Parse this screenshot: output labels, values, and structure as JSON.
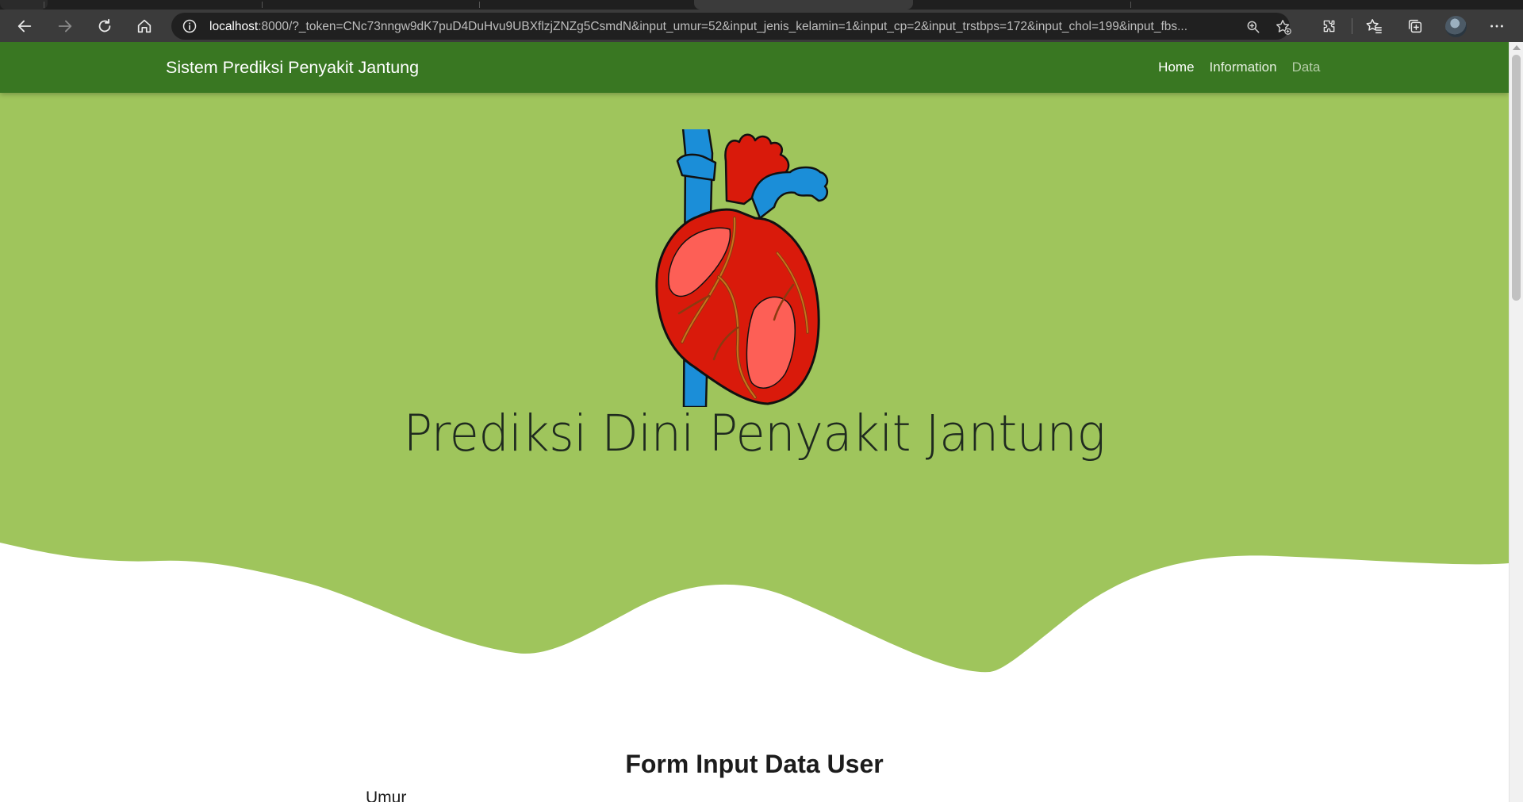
{
  "browser": {
    "url_host": "localhost",
    "url_rest": ":8000/?_token=CNc73nngw9dK7puD4DuHvu9UBXflzjZNZg5CsmdN&input_umur=52&input_jenis_kelamin=1&input_cp=2&input_trstbps=172&input_chol=199&input_fbs...",
    "icons": [
      "back-icon",
      "forward-icon",
      "refresh-icon",
      "home-icon",
      "info-icon",
      "zoom-icon",
      "add-favorite-icon",
      "extensions-icon",
      "favorites-icon",
      "collections-icon",
      "profile-avatar",
      "more-icon"
    ]
  },
  "navbar": {
    "brand": "Sistem Prediksi Penyakit Jantung",
    "links": [
      {
        "label": "Home"
      },
      {
        "label": "Information"
      },
      {
        "label": "Data"
      }
    ]
  },
  "hero": {
    "title": "Prediksi Dini Penyakit Jantung"
  },
  "form": {
    "title": "Form Input Data User",
    "first_label": "Umur"
  },
  "colors": {
    "navbar": "#397722",
    "hero": "#9fc55c",
    "browser_toolbar": "#3b3b3b",
    "heart_red": "#d91a0b",
    "heart_pink": "#fd5f56",
    "vessel_blue": "#1b8ed8"
  }
}
